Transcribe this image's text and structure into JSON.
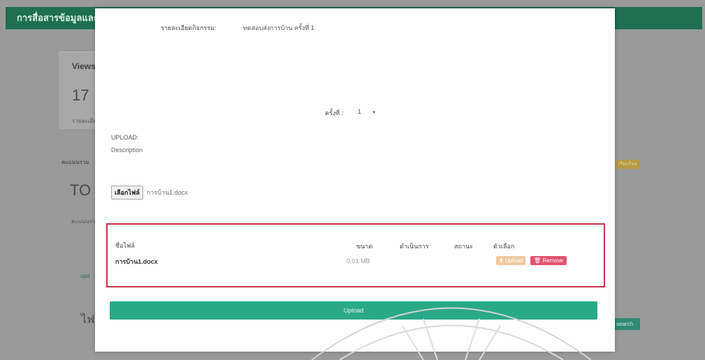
{
  "background": {
    "header_title": "การสื่อสารข้อมูลและ",
    "views_label": "Views",
    "views_count": "17",
    "views_sub": "รายละเอียด",
    "section_label": "คะแนนรวม",
    "total_prefix": "TO",
    "total_sub": "คะแนนรวม",
    "badge": "เรียบร้อย",
    "link_text": "upd",
    "bottom_char": "ไฟ",
    "search_button": "search"
  },
  "modal": {
    "item_label": "รายละเอียดกิจกรรม:",
    "item_value": "ทดสอบส่งการบ้าน ครั้งที่ 1",
    "round_label": "ครั้งที่ :",
    "round_value": "1",
    "round_caret": "▾",
    "upload_label": "UPLOAD:",
    "description_label": "Description",
    "choose_file_label": "เลือกไฟล์",
    "chosen_file_name": "การบ้าน1.docx",
    "table": {
      "headers": {
        "name": "ชื่อไฟล์",
        "size": "ขนาด",
        "progress": "ดำเนินการ",
        "status": "สถานะ",
        "options": "ตัวเลือก"
      },
      "rows": [
        {
          "name": "การบ้าน1.docx",
          "size": "0.01 MB",
          "upload_label": "Upload",
          "remove_label": "Remove",
          "remove_icon": "trash-icon"
        }
      ]
    },
    "upload_button": "Upload"
  }
}
